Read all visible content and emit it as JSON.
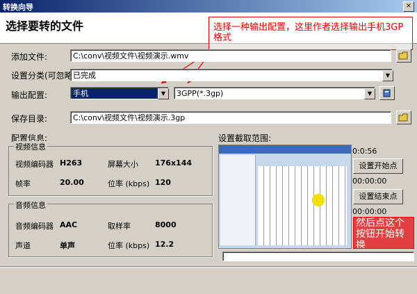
{
  "window": {
    "title": "转换向导",
    "close": "×"
  },
  "header": {
    "title": "选择要转的文件"
  },
  "annotation_top": "选择一种输出配置，这里作者选择输出手机3GP格式",
  "form": {
    "add_file_label": "添加文件:",
    "add_file_value": "C:\\conv\\视频文件\\视频演示.wmv",
    "category_label": "设置分类(可忽略)",
    "category_value": "已完成",
    "output_config_label": "输出配置:",
    "output_config_value": "手机",
    "output_format_value": "3GPP(*.3gp)",
    "save_dir_label": "保存目录:",
    "save_dir_value": "C:\\conv\\视频文件\\视频演示.3gp"
  },
  "config": {
    "title": "配置信息:",
    "video_group": "视频信息",
    "video_encoder_label": "视频编码器",
    "video_encoder_value": "H263",
    "screen_size_label": "屏幕大小",
    "screen_size_value": "176x144",
    "framerate_label": "帧率",
    "framerate_value": "20.00",
    "video_bitrate_label": "位率 (kbps)",
    "video_bitrate_value": "120",
    "audio_group": "音频信息",
    "audio_encoder_label": "音频编码器",
    "audio_encoder_value": "AAC",
    "samplerate_label": "取样率",
    "samplerate_value": "8000",
    "channel_label": "声道",
    "channel_value": "单声",
    "audio_bitrate_label": "位率 (kbps)",
    "audio_bitrate_value": "12.2"
  },
  "range": {
    "title": "设置截取范围:",
    "start_time": "0:0:56",
    "start_button": "设置开始点",
    "end_time": "00:00:00",
    "end_button": "设置结束点",
    "end_time2": "00:00:00"
  },
  "annotation_bottom": "然后点这个按钮开始转换"
}
